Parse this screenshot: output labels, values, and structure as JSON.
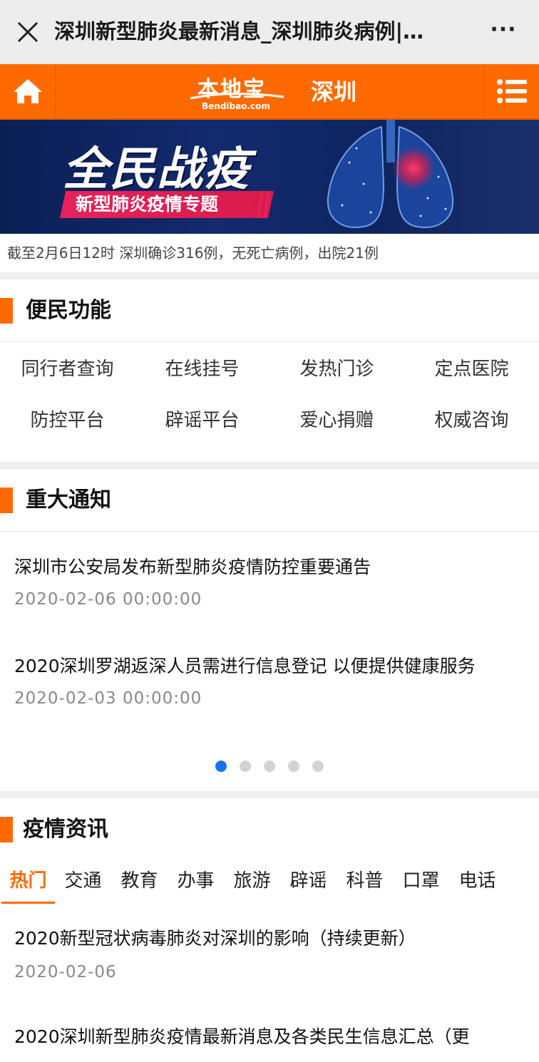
{
  "titlebar": {
    "title": "深圳新型肺炎最新消息_深圳肺炎病例|…",
    "more_label": "···"
  },
  "header": {
    "logo_text": "本地宝",
    "logo_domain": "Bendibao.com",
    "city": "深圳",
    "accent_color": "#ff6a00"
  },
  "banner": {
    "headline": "全民战疫",
    "subtitle": "新型肺炎疫情专题"
  },
  "stats": {
    "text": "截至2月6日12时 深圳确诊316例，无死亡病例，出院21例"
  },
  "services": {
    "heading": "便民功能",
    "items": [
      "同行者查询",
      "在线挂号",
      "发热门诊",
      "定点医院",
      "防控平台",
      "辟谣平台",
      "爱心捐赠",
      "权威咨询"
    ]
  },
  "notices": {
    "heading": "重大通知",
    "items": [
      {
        "title": "深圳市公安局发布新型肺炎疫情防控重要通告",
        "date": "2020-02-06 00:00:00"
      },
      {
        "title": "2020深圳罗湖返深人员需进行信息登记 以便提供健康服务",
        "date": "2020-02-03 00:00:00"
      }
    ],
    "carousel_pages": 5,
    "carousel_active": 1
  },
  "news": {
    "heading": "疫情资讯",
    "tabs": [
      "热门",
      "交通",
      "教育",
      "办事",
      "旅游",
      "辟谣",
      "科普",
      "口罩",
      "电话"
    ],
    "active_tab": "热门",
    "items": [
      {
        "title": "2020新型冠状病毒肺炎对深圳的影响（持续更新）",
        "date": "2020-02-06"
      },
      {
        "title": "2020深圳新型肺炎疫情最新消息及各类民生信息汇总（更",
        "date": ""
      }
    ]
  },
  "icons": {
    "close": "close-icon",
    "home": "home-icon",
    "menu": "menu-list-icon"
  }
}
